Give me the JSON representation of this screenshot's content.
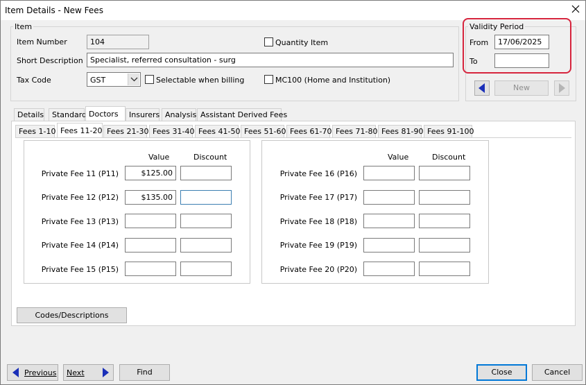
{
  "window": {
    "title": "Item Details - New Fees"
  },
  "item_group": {
    "label": "Item",
    "item_number_label": "Item Number",
    "item_number_value": "104",
    "quantity_item_label": "Quantity Item",
    "short_description_label": "Short Description",
    "short_description_value": "Specialist, referred consultation - surg",
    "tax_code_label": "Tax Code",
    "tax_code_value": "GST",
    "selectable_label": "Selectable when billing",
    "mc100_label": "MC100 (Home and Institution)"
  },
  "validity": {
    "label": "Validity Period",
    "from_label": "From",
    "from_value": "17/06/2025",
    "to_label": "To",
    "to_value": "",
    "new_label": "New"
  },
  "tabs": [
    "Details",
    "Standard",
    "Doctors",
    "Insurers",
    "Analysis",
    "Assistant Derived Fees"
  ],
  "active_tab": "Doctors",
  "fee_tabs": [
    "Fees 1-10",
    "Fees 11-20",
    "Fees 21-30",
    "Fees 31-40",
    "Fees 41-50",
    "Fees 51-60",
    "Fees 61-70",
    "Fees 71-80",
    "Fees 81-90",
    "Fees 91-100"
  ],
  "active_fee_tab": "Fees 11-20",
  "fees": {
    "value_header": "Value",
    "discount_header": "Discount",
    "left": [
      {
        "label": "Private Fee 11 (P11)",
        "value": "$125.00",
        "discount": ""
      },
      {
        "label": "Private Fee 12 (P12)",
        "value": "$135.00",
        "discount": ""
      },
      {
        "label": "Private Fee 13 (P13)",
        "value": "",
        "discount": ""
      },
      {
        "label": "Private Fee 14 (P14)",
        "value": "",
        "discount": ""
      },
      {
        "label": "Private Fee 15 (P15)",
        "value": "",
        "discount": ""
      }
    ],
    "right": [
      {
        "label": "Private Fee 16 (P16)",
        "value": "",
        "discount": ""
      },
      {
        "label": "Private Fee 17 (P17)",
        "value": "",
        "discount": ""
      },
      {
        "label": "Private Fee 18 (P18)",
        "value": "",
        "discount": ""
      },
      {
        "label": "Private Fee 19 (P19)",
        "value": "",
        "discount": ""
      },
      {
        "label": "Private Fee 20 (P20)",
        "value": "",
        "discount": ""
      }
    ]
  },
  "codes_button": "Codes/Descriptions",
  "footer": {
    "previous": "Previous",
    "next": "Next",
    "find": "Find",
    "close": "Close",
    "cancel": "Cancel"
  },
  "colors": {
    "highlight": "#d6243d",
    "arrow": "#1a2fb8",
    "focus": "#3c7fb1"
  }
}
